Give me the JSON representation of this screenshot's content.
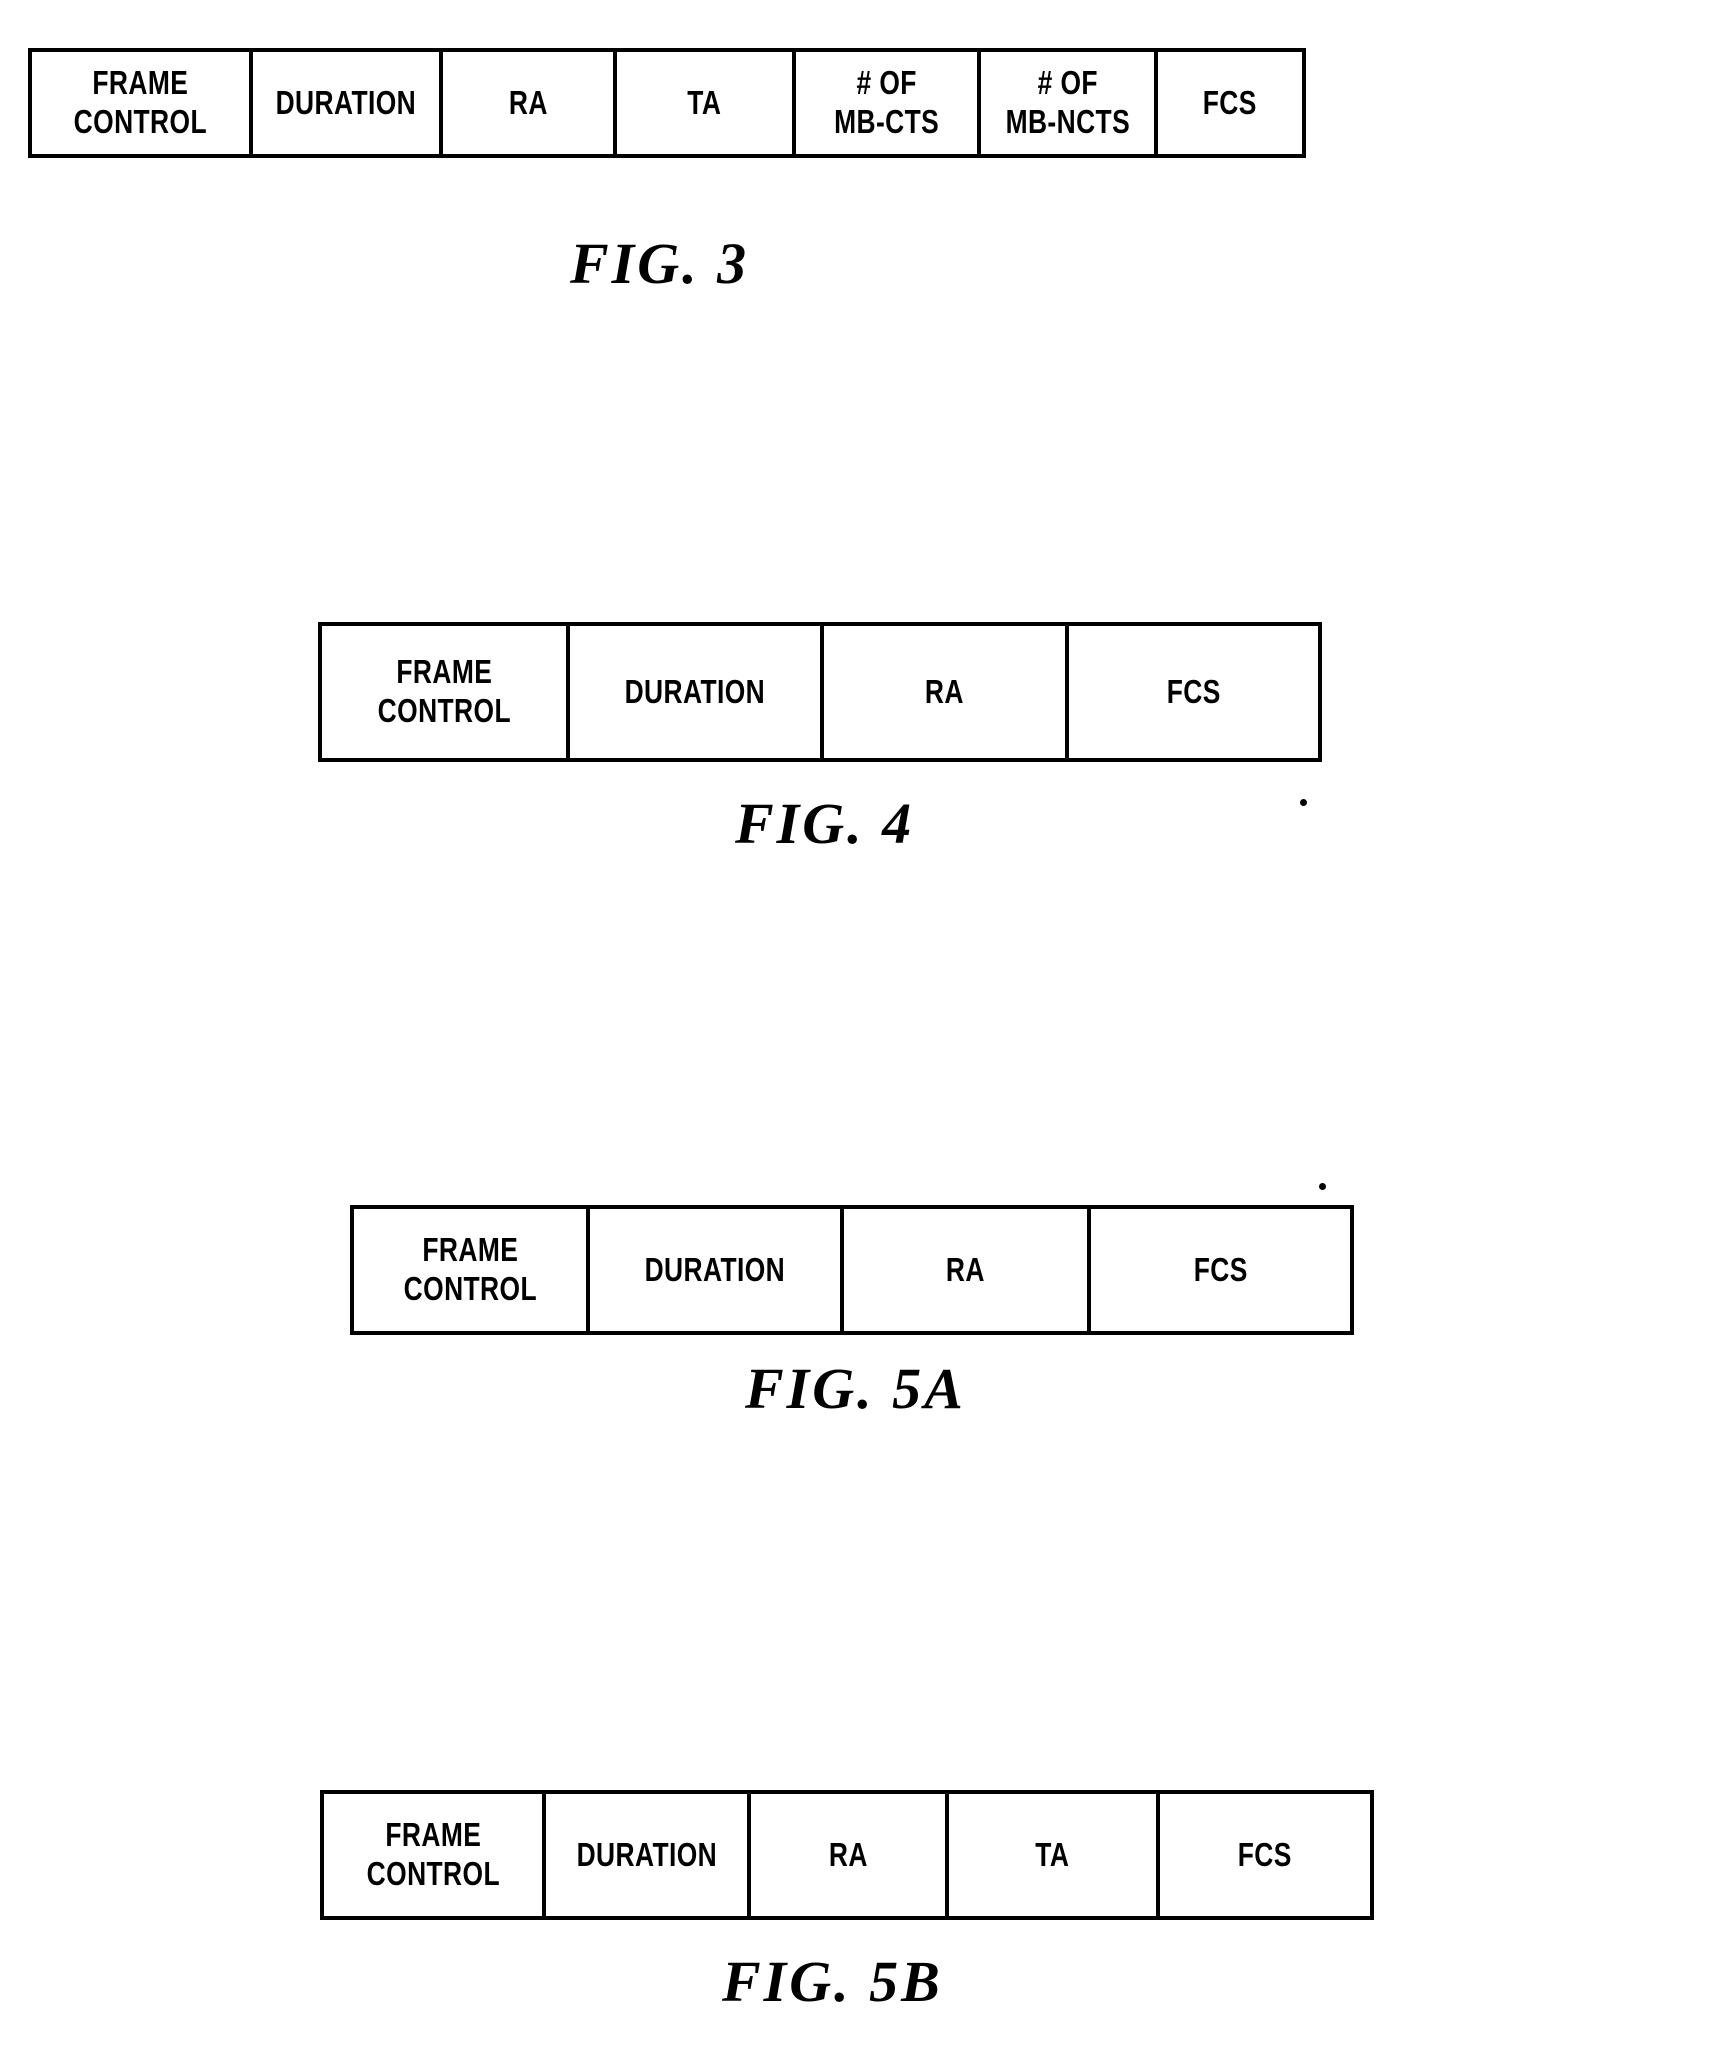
{
  "page": {
    "type": "patent-figure-sheet",
    "background_color": "#ffffff",
    "ink_color": "#000000"
  },
  "figures": [
    {
      "id": "fig-3",
      "caption": "FIG. 3",
      "cells": [
        {
          "label": "FRAME\nCONTROL"
        },
        {
          "label": "DURATION"
        },
        {
          "label": "RA"
        },
        {
          "label": "TA"
        },
        {
          "label": "# OF\nMB-CTS"
        },
        {
          "label": "# OF\nMB-NCTS"
        },
        {
          "label": "FCS"
        }
      ]
    },
    {
      "id": "fig-4",
      "caption": "FIG. 4",
      "cells": [
        {
          "label": "FRAME\nCONTROL"
        },
        {
          "label": "DURATION"
        },
        {
          "label": "RA"
        },
        {
          "label": "FCS"
        }
      ]
    },
    {
      "id": "fig-5a",
      "caption": "FIG. 5A",
      "cells": [
        {
          "label": "FRAME\nCONTROL"
        },
        {
          "label": "DURATION"
        },
        {
          "label": "RA"
        },
        {
          "label": "FCS"
        }
      ]
    },
    {
      "id": "fig-5b",
      "caption": "FIG. 5B",
      "cells": [
        {
          "label": "FRAME\nCONTROL"
        },
        {
          "label": "DURATION"
        },
        {
          "label": "RA"
        },
        {
          "label": "TA"
        },
        {
          "label": "FCS"
        }
      ]
    }
  ]
}
